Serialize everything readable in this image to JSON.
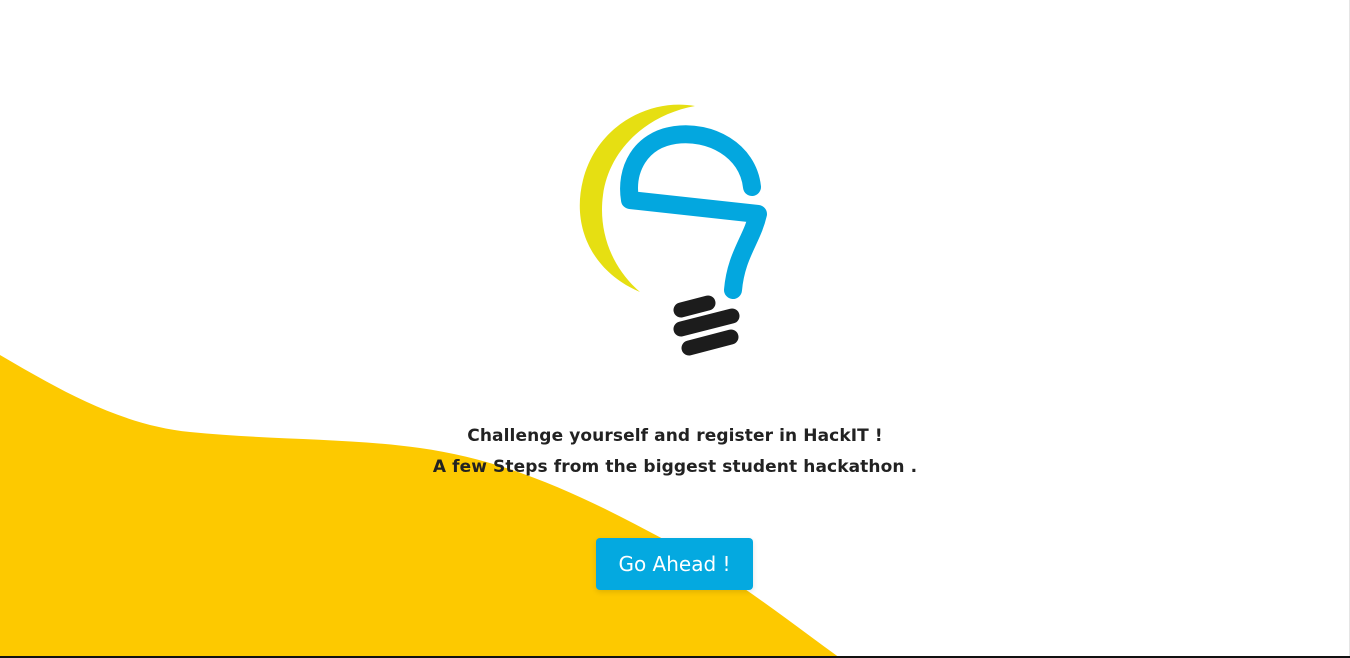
{
  "hero": {
    "line1": "Challenge yourself and register in HackIT !",
    "line2": "A few Steps from the biggest student hackathon ."
  },
  "cta": {
    "label": "Go Ahead !"
  },
  "logo": {
    "icon": "lightbulb-logo-icon"
  },
  "colors": {
    "background": "#ffffff",
    "wave": "#fdc900",
    "button": "#04a9e0",
    "bulb_blue": "#03a7df",
    "bulb_yellow": "#e6df12",
    "bulb_base": "#1c1c1c",
    "text": "#222222"
  }
}
